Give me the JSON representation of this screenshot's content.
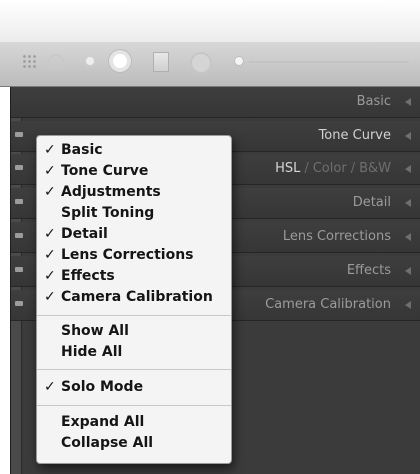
{
  "toolbar": {
    "tools": [
      "grid-overlay-icon",
      "crop-icon",
      "red-eye-icon",
      "spot-removal-icon",
      "graduated-filter-icon",
      "radial-filter-icon",
      "adjustment-brush-icon"
    ]
  },
  "panels": [
    {
      "label": "Basic",
      "toggle": false
    },
    {
      "label": "Tone Curve",
      "toggle": true
    },
    {
      "label_parts": [
        "HSL",
        "Color",
        "B&W"
      ],
      "toggle": true
    },
    {
      "label": "Detail",
      "toggle": true
    },
    {
      "label": "Lens Corrections",
      "toggle": true
    },
    {
      "label": "Effects",
      "toggle": true
    },
    {
      "label": "Camera Calibration",
      "toggle": true
    }
  ],
  "menu": {
    "items": [
      {
        "label": "Basic",
        "checked": true
      },
      {
        "label": "Tone Curve",
        "checked": true
      },
      {
        "label": "Adjustments",
        "checked": true
      },
      {
        "label": "Split Toning",
        "checked": false
      },
      {
        "label": "Detail",
        "checked": true
      },
      {
        "label": "Lens Corrections",
        "checked": true
      },
      {
        "label": "Effects",
        "checked": true
      },
      {
        "label": "Camera Calibration",
        "checked": true
      }
    ],
    "view_items": [
      {
        "label": "Show All"
      },
      {
        "label": "Hide All"
      }
    ],
    "mode_items": [
      {
        "label": "Solo Mode",
        "checked": true
      }
    ],
    "expand_items": [
      {
        "label": "Expand All"
      },
      {
        "label": "Collapse All"
      }
    ],
    "check_glyph": "✓"
  }
}
